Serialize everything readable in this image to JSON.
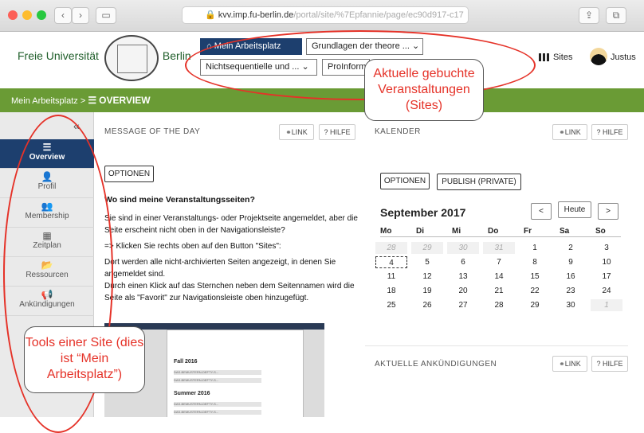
{
  "browser": {
    "url_main": "kvv.imp.fu-berlin.de",
    "url_rest": "/portal/site/%7Epfannie/page/ec90d917-c17"
  },
  "header": {
    "logo_left": "Freie Universität",
    "logo_right": "Berlin",
    "nav_active": "Mein Arbeitsplatz",
    "nav_site1": "Grundlagen der theore ...",
    "nav_site2": "Nichtsequentielle und ...",
    "nav_site3": "ProInform",
    "sites_label": "Sites",
    "user": "Justus"
  },
  "breadcrumb": {
    "root": "Mein Arbeitsplatz",
    "sep": ">",
    "current": "OVERVIEW"
  },
  "sidebar": {
    "items": [
      {
        "label": "Overview",
        "icon": "☰"
      },
      {
        "label": "Profil",
        "icon": "👤"
      },
      {
        "label": "Membership",
        "icon": "👥"
      },
      {
        "label": "Zeitplan",
        "icon": "▦"
      },
      {
        "label": "Ressourcen",
        "icon": "📂"
      },
      {
        "label": "Ankündigungen",
        "icon": "📢"
      }
    ]
  },
  "motd": {
    "title": "MESSAGE OF THE DAY",
    "link": "LINK",
    "hilfe": "? HILFE",
    "options": "OPTIONEN",
    "heading": "Wo sind meine Veranstaltungsseiten?",
    "p1": "Sie sind in einer Veranstaltungs- oder Projektseite angemeldet, aber die Seite erscheint nicht oben in der Navigationsleiste?",
    "p2": "=> Klicken Sie rechts oben auf den Button \"Sites\":",
    "p3": "Dort werden alle nicht-archivierten Seiten angezeigt,  in denen Sie angemeldet sind.",
    "p4": "Durch einen Klick auf das Sternchen neben dem Seitennamen wird die Seite als \"Favorit\" zur Navigationsleiste oben hinzugefügt."
  },
  "shot": {
    "t1": "Fall 2016",
    "t2": "Summer 2016",
    "item": "DAS-BEMUSTERN-DEFTY-S..."
  },
  "calendar": {
    "title": "KALENDER",
    "link": "LINK",
    "hilfe": "? HILFE",
    "options": "OPTIONEN",
    "publish": "PUBLISH (PRIVATE)",
    "month": "September 2017",
    "prev": "<",
    "today": "Heute",
    "next": ">",
    "dow": [
      "Mo",
      "Di",
      "Mi",
      "Do",
      "Fr",
      "Sa",
      "So"
    ],
    "weeks": [
      [
        "28",
        "29",
        "30",
        "31",
        "1",
        "2",
        "3"
      ],
      [
        "4",
        "5",
        "6",
        "7",
        "8",
        "9",
        "10"
      ],
      [
        "11",
        "12",
        "13",
        "14",
        "15",
        "16",
        "17"
      ],
      [
        "18",
        "19",
        "20",
        "21",
        "22",
        "23",
        "24"
      ],
      [
        "25",
        "26",
        "27",
        "28",
        "29",
        "30",
        "1"
      ]
    ]
  },
  "announce": {
    "title": "AKTUELLE ANKÜNDIGUNGEN",
    "link": "LINK",
    "hilfe": "? HILFE"
  },
  "annotations": {
    "note1": "Aktuelle gebuchte Veranstaltungen (Sites)",
    "note2": "Tools einer Site (dies ist “Mein Arbeitsplatz”)"
  },
  "colors": {
    "green": "#6a9b35",
    "navy": "#1d3f6e",
    "annotation": "#e53228"
  }
}
